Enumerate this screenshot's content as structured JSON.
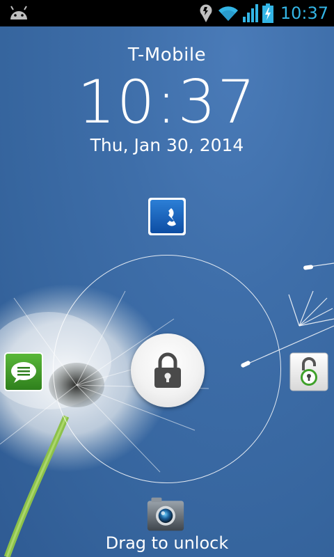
{
  "status_bar": {
    "time": "10:37",
    "icons": [
      "android-debug-icon",
      "location-icon",
      "wifi-icon",
      "signal-icon",
      "battery-charging-icon"
    ],
    "accent_color": "#33b5e5"
  },
  "lockscreen": {
    "carrier": "T-Mobile",
    "time": "10:37",
    "date": "Thu, Jan 30, 2014",
    "hint": "Drag to unlock",
    "targets": [
      "phone-icon",
      "messaging-icon",
      "unlock-icon",
      "camera-icon"
    ]
  }
}
